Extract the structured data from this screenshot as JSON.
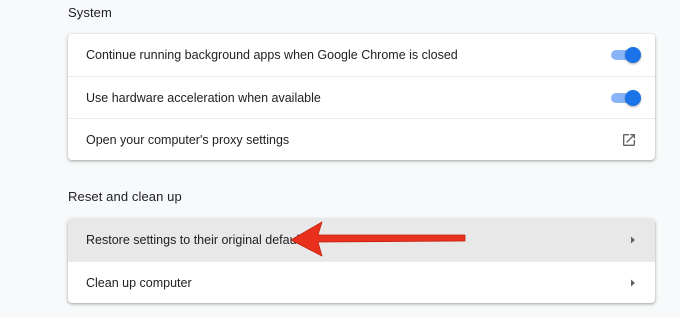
{
  "colors": {
    "accent": "#1a73e8",
    "toggle_track": "#8ab4f8",
    "annotation_arrow": "#e8301c",
    "row_highlight": "#e8e8e8"
  },
  "system": {
    "title": "System",
    "rows": [
      {
        "label": "Continue running background apps when Google Chrome is closed",
        "control": "toggle",
        "checked": true
      },
      {
        "label": "Use hardware acceleration when available",
        "control": "toggle",
        "checked": true
      },
      {
        "label": "Open your computer's proxy settings",
        "control": "open-in-new-icon"
      }
    ]
  },
  "reset": {
    "title": "Reset and clean up",
    "rows": [
      {
        "label": "Restore settings to their original defaults",
        "control": "arrow-right-icon",
        "highlighted": true
      },
      {
        "label": "Clean up computer",
        "control": "arrow-right-icon"
      }
    ]
  },
  "annotation": {
    "type": "red-arrow",
    "points_to": "Restore settings to their original defaults"
  }
}
